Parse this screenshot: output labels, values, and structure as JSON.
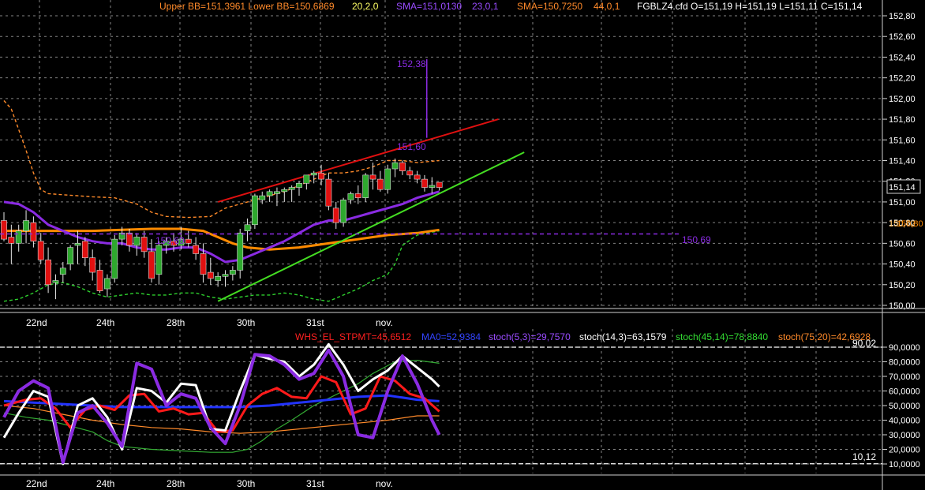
{
  "colors": {
    "background": "#000000",
    "grid": "#bbbbbb",
    "up_candle": "#2ea82e",
    "down_candle": "#e01010",
    "bb_upper": "#ff8a2a",
    "bb_lower": "#2ed12e",
    "sma_short": "#8a2be2",
    "sma_long": "#ff8a00",
    "trend_red": "#e01010",
    "trend_green": "#44dd22",
    "level": "#8a2be2"
  },
  "legend": {
    "bb": "Upper BB=151,3961 Lower BB=150,6869",
    "bb_params": "20,2,0",
    "sma1": "SMA=151,0130",
    "sma1_params": "23,0,1",
    "sma2": "SMA=150,7250",
    "sma2_params": "44,0,1",
    "ohlc": "FGBLZ4.cfd O=151,19 H=151,19 L=151,11 C=151,14"
  },
  "price_axis": {
    "ticks": [
      "152,80",
      "152,60",
      "152,40",
      "152,20",
      "152,00",
      "151,80",
      "151,60",
      "151,40",
      "151,20",
      "151,00",
      "150,80",
      "150,60",
      "150,40",
      "150,20",
      "150,00"
    ],
    "current_price": "151,14",
    "sma_labels": [
      "150,72",
      "150,80"
    ]
  },
  "annotations": {
    "peak": "152,38",
    "channel_point": "151,60",
    "level_left": "150,69",
    "level_right": "150,69"
  },
  "x_axis": {
    "labels": [
      "22nd",
      "24th",
      "28th",
      "30th",
      "31st",
      "nov."
    ]
  },
  "indicator": {
    "legend": {
      "whs": "WHS_EL_STPMT=45,6512",
      "ma0": "MA0=52,9384",
      "stoch53": "stoch(5,3)=29,7570",
      "stoch143": "stoch(14,3)=63,1579",
      "stoch4514": "stoch(45,14)=78,8840",
      "stoch7520": "stoch(75,20)=42,6928"
    },
    "upper_level": "90,02",
    "lower_level": "10,12",
    "ticks": [
      "90,0000",
      "80,0000",
      "70,0000",
      "60,0000",
      "50,0000",
      "40,0000",
      "30,0000",
      "20,0000",
      "10,0000"
    ]
  },
  "chart_data": {
    "type": "candlestick",
    "ylim": [
      150.0,
      152.8
    ],
    "candles": [
      [
        150.82,
        150.9,
        150.62,
        150.64
      ],
      [
        150.66,
        150.78,
        150.4,
        150.6
      ],
      [
        150.6,
        150.78,
        150.52,
        150.72
      ],
      [
        150.72,
        150.92,
        150.6,
        150.82
      ],
      [
        150.8,
        150.86,
        150.56,
        150.62
      ],
      [
        150.62,
        150.7,
        150.4,
        150.44
      ],
      [
        150.44,
        150.56,
        150.12,
        150.2
      ],
      [
        150.22,
        150.3,
        150.06,
        150.24
      ],
      [
        150.3,
        150.42,
        150.22,
        150.36
      ],
      [
        150.4,
        150.58,
        150.34,
        150.56
      ],
      [
        150.58,
        150.72,
        150.4,
        150.6
      ],
      [
        150.62,
        150.66,
        150.38,
        150.46
      ],
      [
        150.46,
        150.54,
        150.24,
        150.32
      ],
      [
        150.34,
        150.44,
        150.12,
        150.14
      ],
      [
        150.16,
        150.3,
        150.08,
        150.26
      ],
      [
        150.26,
        150.68,
        150.22,
        150.64
      ],
      [
        150.64,
        150.76,
        150.58,
        150.7
      ],
      [
        150.7,
        150.74,
        150.52,
        150.58
      ],
      [
        150.58,
        150.7,
        150.48,
        150.66
      ],
      [
        150.66,
        150.72,
        150.46,
        150.52
      ],
      [
        150.52,
        150.64,
        150.22,
        150.26
      ],
      [
        150.3,
        150.62,
        150.2,
        150.58
      ],
      [
        150.58,
        150.66,
        150.5,
        150.62
      ],
      [
        150.62,
        150.7,
        150.52,
        150.58
      ],
      [
        150.58,
        150.76,
        150.54,
        150.64
      ],
      [
        150.64,
        150.72,
        150.56,
        150.6
      ],
      [
        150.58,
        150.66,
        150.44,
        150.5
      ],
      [
        150.5,
        150.6,
        150.22,
        150.3
      ],
      [
        150.32,
        150.46,
        150.2,
        150.26
      ],
      [
        150.24,
        150.32,
        150.18,
        150.28
      ],
      [
        150.28,
        150.34,
        150.18,
        150.3
      ],
      [
        150.3,
        150.38,
        150.24,
        150.34
      ],
      [
        150.34,
        150.74,
        150.26,
        150.7
      ],
      [
        150.72,
        150.84,
        150.62,
        150.78
      ],
      [
        150.78,
        151.08,
        150.74,
        151.06
      ],
      [
        151.02,
        151.1,
        150.98,
        151.06
      ],
      [
        151.06,
        151.12,
        151.0,
        151.1
      ],
      [
        151.08,
        151.14,
        150.96,
        151.1
      ],
      [
        151.1,
        151.14,
        151.0,
        151.12
      ],
      [
        151.12,
        151.16,
        151.0,
        151.14
      ],
      [
        151.14,
        151.2,
        151.06,
        151.18
      ],
      [
        151.18,
        151.26,
        151.12,
        151.26
      ],
      [
        151.26,
        151.3,
        151.18,
        151.28
      ],
      [
        151.28,
        151.36,
        151.16,
        151.22
      ],
      [
        151.22,
        151.28,
        150.92,
        150.96
      ],
      [
        150.94,
        151.0,
        150.74,
        150.8
      ],
      [
        150.8,
        151.04,
        150.76,
        151.02
      ],
      [
        151.02,
        151.1,
        150.98,
        151.08
      ],
      [
        151.08,
        151.16,
        150.98,
        151.04
      ],
      [
        151.04,
        151.28,
        151.0,
        151.26
      ],
      [
        151.26,
        151.38,
        151.12,
        151.22
      ],
      [
        151.22,
        151.3,
        151.1,
        151.12
      ],
      [
        151.12,
        151.36,
        151.08,
        151.32
      ],
      [
        151.32,
        151.42,
        151.24,
        151.38
      ],
      [
        151.38,
        151.4,
        151.26,
        151.3
      ],
      [
        151.3,
        151.34,
        151.22,
        151.26
      ],
      [
        151.26,
        151.3,
        151.18,
        151.22
      ],
      [
        151.22,
        151.26,
        151.1,
        151.14
      ],
      [
        151.14,
        151.24,
        151.08,
        151.16
      ],
      [
        151.19,
        151.19,
        151.11,
        151.14
      ]
    ]
  }
}
